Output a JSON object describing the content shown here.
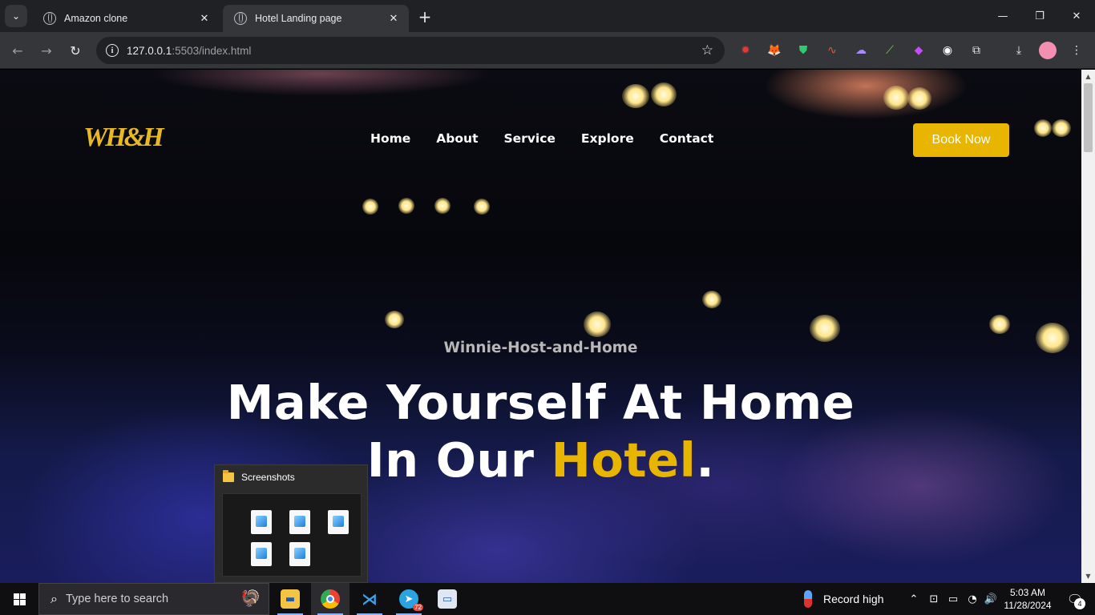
{
  "browser": {
    "tabs": [
      {
        "title": "Amazon clone",
        "active": false
      },
      {
        "title": "Hotel Landing page",
        "active": true
      }
    ],
    "url_host": "127.0.0.1",
    "url_path": ":5503/index.html",
    "extension_icons": [
      "record-icon",
      "metamask-icon",
      "shield-icon",
      "scribble-icon",
      "ghost-icon",
      "chart-icon",
      "gem-icon",
      "game-icon",
      "puzzle-icon"
    ]
  },
  "site": {
    "logo": "WH&H",
    "nav": [
      "Home",
      "About",
      "Service",
      "Explore",
      "Contact"
    ],
    "cta": "Book Now",
    "subtitle": "Winnie-Host-and-Home",
    "headline_line1": "Make Yourself At Home",
    "headline_line2_prefix": "In Our ",
    "headline_accent": "Hotel",
    "headline_suffix": ".",
    "accent_color": "#e8b500"
  },
  "popup": {
    "title": "Screenshots"
  },
  "taskbar": {
    "search_placeholder": "Type here to search",
    "telegram_badge": "72",
    "weather_text": "Record high",
    "time": "5:03 AM",
    "date": "11/28/2024",
    "notification_count": "4"
  }
}
